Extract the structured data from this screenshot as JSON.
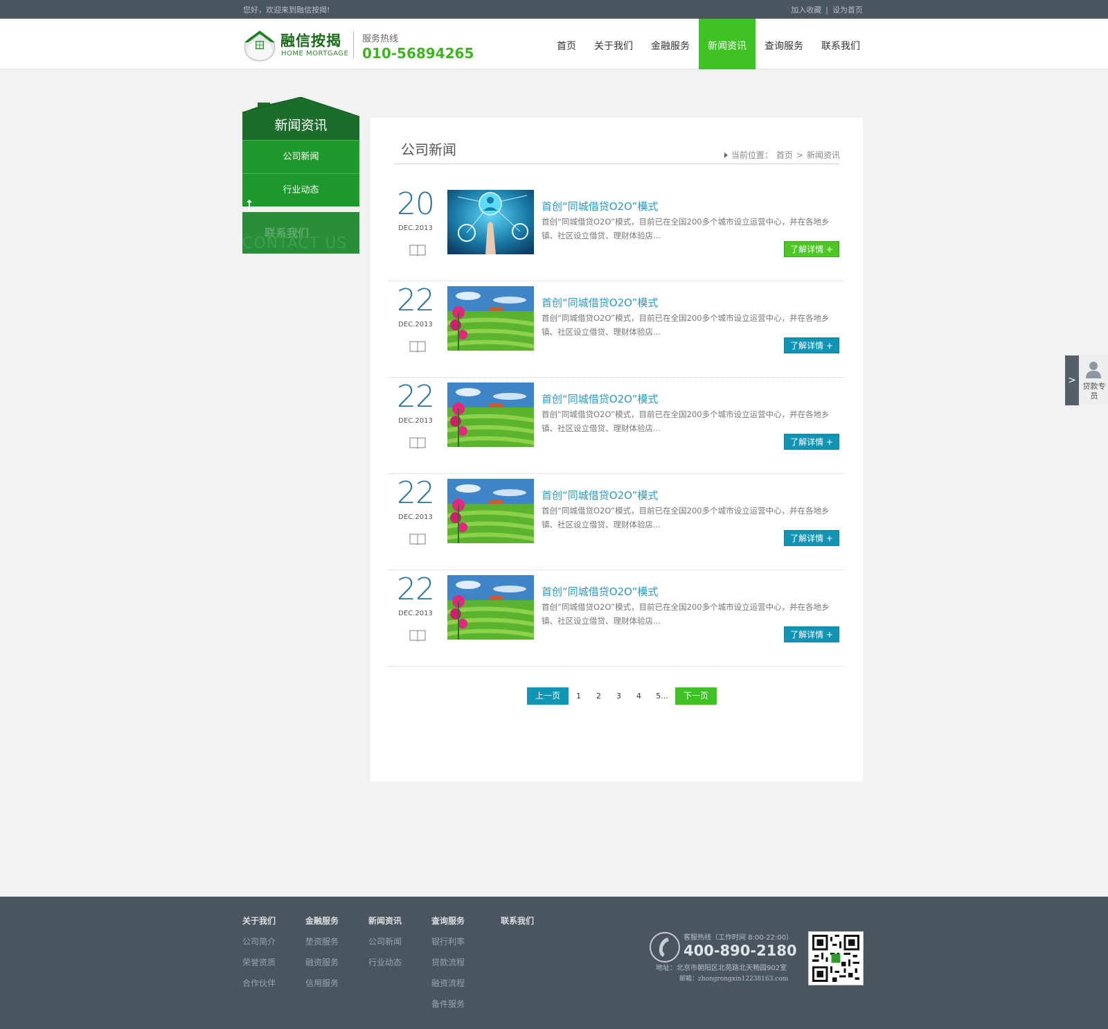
{
  "topbar": {
    "welcome": "您好，欢迎来到融信按揭!",
    "favorite": "加入收藏",
    "separator": "|",
    "homepage": "设为首页"
  },
  "header": {
    "brand": "融信按揭",
    "brand_en": "HOME MORTGAGE",
    "hotline_label": "服务热线",
    "hotline_number": "010-56894265"
  },
  "nav": {
    "items": [
      "首页",
      "关于我们",
      "金融服务",
      "新闻资讯",
      "查询服务",
      "联系我们"
    ],
    "active_index": 3
  },
  "sidebar": {
    "title": "新闻资讯",
    "items": [
      "公司新闻",
      "行业动态"
    ],
    "contact_cn": "联系我们",
    "contact_en": "CONTACT US"
  },
  "main": {
    "title": "公司新闻",
    "breadcrumb_label": "当前位置：",
    "breadcrumb_home": "首页",
    "breadcrumb_sep": ">",
    "breadcrumb_current": "新闻资讯",
    "news": [
      {
        "day": "20",
        "month": "DEC.2013",
        "headline": "首创“同城借贷O2O”模式",
        "desc": "首创“同城借贷O2O”模式，目前已在全国200多个城市设立运营中心，并在各地乡镇、社区设立借贷、理财体验店...",
        "more": "了解详情 +",
        "thumb": "tech-hand-icon",
        "highlight": true
      },
      {
        "day": "22",
        "month": "DEC.2013",
        "headline": "首创“同城借贷O2O”模式",
        "desc": "首创“同城借贷O2O”模式，目前已在全国200多个城市设立运营中心，并在各地乡镇、社区设立借贷、理财体验店...",
        "more": "了解详情 +",
        "thumb": "field-flower-icon",
        "highlight": false
      },
      {
        "day": "22",
        "month": "DEC.2013",
        "headline": "首创“同城借贷O2O”模式",
        "desc": "首创“同城借贷O2O”模式，目前已在全国200多个城市设立运营中心，并在各地乡镇、社区设立借贷、理财体验店...",
        "more": "了解详情 +",
        "thumb": "field-flower-icon",
        "highlight": false
      },
      {
        "day": "22",
        "month": "DEC.2013",
        "headline": "首创“同城借贷O2O”模式",
        "desc": "首创“同城借贷O2O”模式，目前已在全国200多个城市设立运营中心，并在各地乡镇、社区设立借贷、理财体验店...",
        "more": "了解详情 +",
        "thumb": "field-flower-icon",
        "highlight": false
      },
      {
        "day": "22",
        "month": "DEC.2013",
        "headline": "首创“同城借贷O2O”模式",
        "desc": "首创“同城借贷O2O”模式，目前已在全国200多个城市设立运营中心，并在各地乡镇、社区设立借贷、理财体验店...",
        "more": "了解详情 +",
        "thumb": "field-flower-icon",
        "highlight": false
      }
    ],
    "pager": {
      "prev": "上一页",
      "pages": [
        "1",
        "2",
        "3",
        "4",
        "5..."
      ],
      "next": "下一页"
    }
  },
  "float": {
    "label": "贷款专员",
    "arrow": ">"
  },
  "footer": {
    "columns": [
      {
        "heading": "关于我们",
        "links": [
          "公司简介",
          "荣誉资质",
          "合作伙伴"
        ]
      },
      {
        "heading": "金融服务",
        "links": [
          "垫资服务",
          "融资服务",
          "信用服务"
        ]
      },
      {
        "heading": "新闻资讯",
        "links": [
          "公司新闻",
          "行业动态"
        ]
      },
      {
        "heading": "查询服务",
        "links": [
          "银行利率",
          "贷款流程",
          "融资流程",
          "备件服务"
        ]
      },
      {
        "heading": "联系我们",
        "links": []
      }
    ],
    "service_label": "客服热线（工作时间 8:00-22:00）",
    "service_phone": "400-890-2180",
    "address": "地址：北京市朝阳区北苑路北天畅园902室",
    "email": "邮箱：zhongrongxin12238163.com"
  },
  "colors": {
    "green": "#3ec225",
    "dark_green": "#1a6a1a",
    "blue": "#1295b4",
    "slate": "#4a5560"
  }
}
